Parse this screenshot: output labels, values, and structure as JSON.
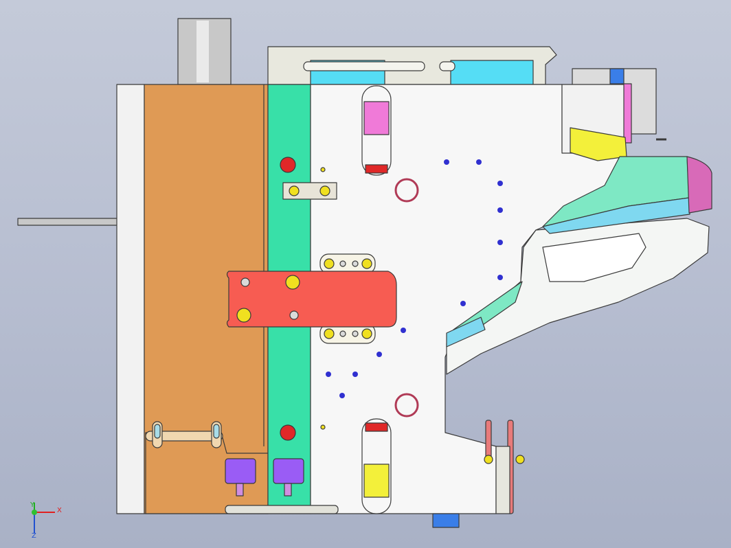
{
  "view": {
    "background_top": "#c4cad9",
    "background_bottom": "#a9b1c6",
    "outline_color": "#3a3a3a"
  },
  "triad": {
    "x_label": "X",
    "y_label": "Y",
    "z_label": "Z",
    "x_color": "#e02020",
    "y_color": "#20b020",
    "z_color": "#2050d0"
  },
  "parts": {
    "clamp_plate": "#f2f2f2",
    "spacer_block": "#df9a55",
    "guide_rail": "#38e0a8",
    "cavity_plate": "#f7f7f7",
    "top_slide_plate": "#e8e8de",
    "top_slide_insert": "#55ddf5",
    "push_block": "#f75c52",
    "pin_yellow": "#f0e020",
    "pin_red": "#e02828",
    "pin_blue": "#3030d0",
    "cylinder": "#c8c8c8",
    "pink_insert": "#f07ad8",
    "lifter_purple": "#9a5cf5",
    "part_yellow": "#f3f03a",
    "part_teal": "#7ee8c4",
    "part_cyan": "#7fd8f0",
    "part_magenta": "#d86ab8",
    "part_white": "#f4f6f4",
    "block_blue": "#3a7ee8"
  }
}
